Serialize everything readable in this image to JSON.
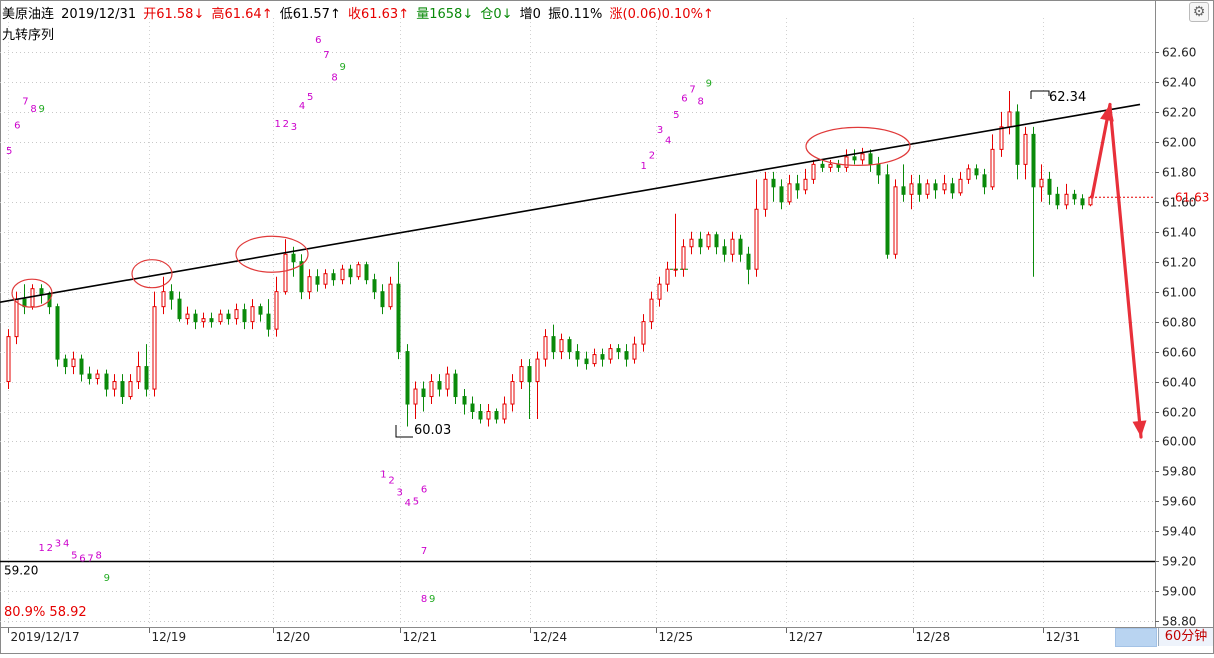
{
  "header": {
    "instrument": "美原油连",
    "date": "2019/12/31",
    "open": "开61.58↓",
    "high": "高61.64↑",
    "low": "低61.57↑",
    "close": "收61.63↑",
    "volume": "量1658↓",
    "position": "仓0↓",
    "increase": "增0",
    "amplitude": "振0.11%",
    "change": "涨(0.06)0.10%↑",
    "indicator": "九转序列"
  },
  "colors": {
    "up": "#e60000",
    "down": "#0a8a0a",
    "nine_up": "#cc00cc",
    "nine_nine": "#22aa22",
    "arrow": "#e8303a",
    "ellipse": "#e03a3a"
  },
  "footer": {
    "pct_note": "80.9% 58.92",
    "period": "60分钟"
  },
  "chart_data": {
    "type": "candlestick",
    "y_axis": {
      "ylim": [
        58.8,
        62.7
      ],
      "ticks": [
        "62.60",
        "62.40",
        "62.20",
        "62.00",
        "61.80",
        "61.60",
        "61.40",
        "61.20",
        "61.00",
        "60.80",
        "60.60",
        "60.40",
        "60.20",
        "60.00",
        "59.80",
        "59.60",
        "59.40",
        "59.20",
        "59.00",
        "58.80"
      ],
      "current_price": "61.63"
    },
    "x_axis": {
      "ticks": [
        "2019/12/17",
        "12/19",
        "12/20",
        "12/21",
        "12/24",
        "12/25",
        "12/27",
        "12/28",
        "12/31"
      ]
    },
    "annotations": {
      "high_label": "62.34",
      "low_label": "60.03",
      "support_label": "59.20",
      "support_level": 59.2,
      "trendline": {
        "start": [
          0,
          60.93
        ],
        "end": [
          142,
          62.25
        ]
      }
    },
    "candles": [
      [
        60.4,
        60.7,
        60.35,
        60.75
      ],
      [
        60.7,
        60.95,
        60.65,
        61.0
      ],
      [
        60.95,
        60.9,
        60.85,
        61.05
      ],
      [
        60.9,
        61.02,
        60.88,
        61.05
      ],
      [
        61.02,
        60.98,
        60.92,
        61.05
      ],
      [
        60.98,
        60.9,
        60.85,
        61.0
      ],
      [
        60.9,
        60.55,
        60.5,
        60.92
      ],
      [
        60.55,
        60.5,
        60.45,
        60.58
      ],
      [
        60.5,
        60.55,
        60.45,
        60.6
      ],
      [
        60.55,
        60.45,
        60.4,
        60.58
      ],
      [
        60.45,
        60.42,
        60.38,
        60.5
      ],
      [
        60.42,
        60.45,
        60.38,
        60.48
      ],
      [
        60.45,
        60.35,
        60.3,
        60.48
      ],
      [
        60.35,
        60.4,
        60.3,
        60.45
      ],
      [
        60.4,
        60.3,
        60.25,
        60.45
      ],
      [
        60.3,
        60.4,
        60.28,
        60.45
      ],
      [
        60.4,
        60.5,
        60.35,
        60.6
      ],
      [
        60.5,
        60.35,
        60.3,
        60.65
      ],
      [
        60.35,
        60.9,
        60.3,
        61.0
      ],
      [
        60.9,
        61.0,
        60.85,
        61.1
      ],
      [
        61.0,
        60.95,
        60.88,
        61.05
      ],
      [
        60.95,
        60.82,
        60.8,
        61.0
      ],
      [
        60.82,
        60.85,
        60.78,
        60.9
      ],
      [
        60.85,
        60.8,
        60.75,
        60.88
      ],
      [
        60.8,
        60.82,
        60.76,
        60.86
      ],
      [
        60.82,
        60.8,
        60.76,
        60.86
      ],
      [
        60.8,
        60.85,
        60.78,
        60.88
      ],
      [
        60.85,
        60.82,
        60.78,
        60.88
      ],
      [
        60.82,
        60.88,
        60.78,
        60.92
      ],
      [
        60.88,
        60.8,
        60.75,
        60.92
      ],
      [
        60.8,
        60.9,
        60.75,
        60.95
      ],
      [
        60.9,
        60.85,
        60.8,
        60.92
      ],
      [
        60.85,
        60.75,
        60.7,
        60.95
      ],
      [
        60.75,
        61.0,
        60.7,
        61.1
      ],
      [
        61.0,
        61.25,
        60.98,
        61.35
      ],
      [
        61.25,
        61.2,
        61.1,
        61.3
      ],
      [
        61.2,
        61.0,
        60.95,
        61.25
      ],
      [
        61.0,
        61.1,
        60.95,
        61.15
      ],
      [
        61.1,
        61.05,
        61.0,
        61.15
      ],
      [
        61.05,
        61.12,
        61.02,
        61.15
      ],
      [
        61.12,
        61.08,
        61.04,
        61.15
      ],
      [
        61.08,
        61.15,
        61.05,
        61.18
      ],
      [
        61.15,
        61.1,
        61.05,
        61.18
      ],
      [
        61.1,
        61.18,
        61.08,
        61.2
      ],
      [
        61.18,
        61.08,
        61.05,
        61.2
      ],
      [
        61.08,
        61.0,
        60.95,
        61.12
      ],
      [
        61.0,
        60.9,
        60.85,
        61.05
      ],
      [
        60.9,
        61.05,
        60.88,
        61.1
      ],
      [
        61.05,
        60.6,
        60.55,
        61.2
      ],
      [
        60.6,
        60.25,
        60.1,
        60.65
      ],
      [
        60.25,
        60.35,
        60.15,
        60.4
      ],
      [
        60.35,
        60.3,
        60.2,
        60.4
      ],
      [
        60.3,
        60.4,
        60.25,
        60.45
      ],
      [
        60.4,
        60.35,
        60.3,
        60.45
      ],
      [
        60.35,
        60.45,
        60.3,
        60.5
      ],
      [
        60.45,
        60.3,
        60.25,
        60.48
      ],
      [
        60.3,
        60.25,
        60.18,
        60.35
      ],
      [
        60.25,
        60.2,
        60.15,
        60.3
      ],
      [
        60.2,
        60.15,
        60.12,
        60.25
      ],
      [
        60.15,
        60.2,
        60.1,
        60.25
      ],
      [
        60.2,
        60.15,
        60.12,
        60.22
      ],
      [
        60.15,
        60.25,
        60.12,
        60.3
      ],
      [
        60.25,
        60.4,
        60.2,
        60.45
      ],
      [
        60.4,
        60.5,
        60.35,
        60.55
      ],
      [
        60.5,
        60.4,
        60.15,
        60.55
      ],
      [
        60.4,
        60.55,
        60.15,
        60.6
      ],
      [
        60.55,
        60.7,
        60.5,
        60.75
      ],
      [
        60.7,
        60.6,
        60.55,
        60.78
      ],
      [
        60.6,
        60.68,
        60.55,
        60.72
      ],
      [
        60.68,
        60.6,
        60.55,
        60.7
      ],
      [
        60.6,
        60.55,
        60.5,
        60.65
      ],
      [
        60.55,
        60.52,
        60.48,
        60.6
      ],
      [
        60.52,
        60.58,
        60.5,
        60.62
      ],
      [
        60.58,
        60.55,
        60.5,
        60.62
      ],
      [
        60.55,
        60.62,
        60.52,
        60.65
      ],
      [
        60.62,
        60.6,
        60.55,
        60.65
      ],
      [
        60.6,
        60.55,
        60.5,
        60.65
      ],
      [
        60.55,
        60.65,
        60.52,
        60.7
      ],
      [
        60.65,
        60.8,
        60.6,
        60.85
      ],
      [
        60.8,
        60.95,
        60.75,
        61.0
      ],
      [
        60.95,
        61.05,
        60.9,
        61.1
      ],
      [
        61.05,
        61.15,
        61.0,
        61.2
      ],
      [
        61.15,
        61.15,
        61.1,
        61.52
      ],
      [
        61.15,
        61.3,
        61.1,
        61.35
      ],
      [
        61.3,
        61.35,
        61.25,
        61.4
      ],
      [
        61.35,
        61.3,
        61.25,
        61.4
      ],
      [
        61.3,
        61.38,
        61.28,
        61.4
      ],
      [
        61.38,
        61.3,
        61.25,
        61.4
      ],
      [
        61.3,
        61.25,
        61.2,
        61.35
      ],
      [
        61.25,
        61.35,
        61.2,
        61.4
      ],
      [
        61.35,
        61.25,
        61.2,
        61.38
      ],
      [
        61.25,
        61.15,
        61.05,
        61.3
      ],
      [
        61.15,
        61.55,
        61.1,
        61.75
      ],
      [
        61.55,
        61.75,
        61.5,
        61.8
      ],
      [
        61.75,
        61.7,
        61.6,
        61.8
      ],
      [
        61.7,
        61.6,
        61.55,
        61.75
      ],
      [
        61.6,
        61.72,
        61.58,
        61.78
      ],
      [
        61.72,
        61.68,
        61.62,
        61.78
      ],
      [
        61.68,
        61.75,
        61.65,
        61.82
      ],
      [
        61.75,
        61.85,
        61.72,
        61.88
      ],
      [
        61.85,
        61.83,
        61.8,
        61.88
      ],
      [
        61.83,
        61.85,
        61.8,
        61.88
      ],
      [
        61.85,
        61.83,
        61.8,
        61.88
      ],
      [
        61.83,
        61.9,
        61.8,
        61.95
      ],
      [
        61.9,
        61.88,
        61.85,
        61.95
      ],
      [
        61.88,
        61.92,
        61.85,
        61.96
      ],
      [
        61.92,
        61.85,
        61.8,
        61.95
      ],
      [
        61.85,
        61.78,
        61.72,
        61.9
      ],
      [
        61.78,
        61.25,
        61.22,
        61.85
      ],
      [
        61.25,
        61.7,
        61.22,
        61.75
      ],
      [
        61.7,
        61.65,
        61.6,
        61.85
      ],
      [
        61.65,
        61.72,
        61.55,
        61.78
      ],
      [
        61.72,
        61.65,
        61.6,
        61.78
      ],
      [
        61.65,
        61.72,
        61.62,
        61.75
      ],
      [
        61.72,
        61.68,
        61.62,
        61.75
      ],
      [
        61.68,
        61.72,
        61.65,
        61.78
      ],
      [
        61.72,
        61.66,
        61.62,
        61.76
      ],
      [
        61.66,
        61.75,
        61.64,
        61.8
      ],
      [
        61.75,
        61.82,
        61.72,
        61.85
      ],
      [
        61.82,
        61.78,
        61.75,
        61.85
      ],
      [
        61.78,
        61.7,
        61.65,
        61.82
      ],
      [
        61.7,
        61.95,
        61.68,
        62.05
      ],
      [
        61.95,
        62.1,
        61.9,
        62.2
      ],
      [
        62.1,
        62.2,
        62.05,
        62.34
      ],
      [
        62.2,
        61.85,
        61.75,
        62.25
      ],
      [
        61.85,
        62.05,
        61.75,
        62.1
      ],
      [
        62.05,
        61.7,
        61.1,
        62.1
      ],
      [
        61.7,
        61.75,
        61.6,
        61.85
      ],
      [
        61.75,
        61.65,
        61.58,
        61.8
      ],
      [
        61.65,
        61.58,
        61.55,
        61.7
      ],
      [
        61.58,
        61.65,
        61.55,
        61.72
      ],
      [
        61.65,
        61.62,
        61.58,
        61.68
      ],
      [
        61.62,
        61.58,
        61.55,
        61.65
      ],
      [
        61.58,
        61.63,
        61.57,
        61.64
      ]
    ],
    "td_sequence": [
      {
        "label": "5",
        "i": 0,
        "price": 61.92,
        "kind": "up"
      },
      {
        "label": "6",
        "i": 1,
        "price": 62.09,
        "kind": "up"
      },
      {
        "label": "7",
        "i": 2,
        "price": 62.25,
        "kind": "up"
      },
      {
        "label": "8",
        "i": 3,
        "price": 62.2,
        "kind": "up"
      },
      {
        "label": "9",
        "i": 4,
        "price": 62.2,
        "kind": "nine"
      },
      {
        "label": "1",
        "i": 33,
        "price": 62.1,
        "kind": "up"
      },
      {
        "label": "2",
        "i": 34,
        "price": 62.1,
        "kind": "up"
      },
      {
        "label": "3",
        "i": 35,
        "price": 62.08,
        "kind": "up"
      },
      {
        "label": "4",
        "i": 36,
        "price": 62.22,
        "kind": "up"
      },
      {
        "label": "5",
        "i": 37,
        "price": 62.28,
        "kind": "up"
      },
      {
        "label": "6",
        "i": 38,
        "price": 62.66,
        "kind": "up"
      },
      {
        "label": "7",
        "i": 39,
        "price": 62.56,
        "kind": "up"
      },
      {
        "label": "8",
        "i": 40,
        "price": 62.41,
        "kind": "up"
      },
      {
        "label": "9",
        "i": 41,
        "price": 62.48,
        "kind": "nine"
      },
      {
        "label": "1",
        "i": 78,
        "price": 61.82,
        "kind": "up"
      },
      {
        "label": "2",
        "i": 79,
        "price": 61.89,
        "kind": "up"
      },
      {
        "label": "3",
        "i": 80,
        "price": 62.06,
        "kind": "up"
      },
      {
        "label": "4",
        "i": 81,
        "price": 61.99,
        "kind": "up"
      },
      {
        "label": "5",
        "i": 82,
        "price": 62.16,
        "kind": "up"
      },
      {
        "label": "6",
        "i": 83,
        "price": 62.27,
        "kind": "up"
      },
      {
        "label": "7",
        "i": 84,
        "price": 62.33,
        "kind": "up"
      },
      {
        "label": "8",
        "i": 85,
        "price": 62.25,
        "kind": "up"
      },
      {
        "label": "9",
        "i": 86,
        "price": 62.37,
        "kind": "nine"
      },
      {
        "label": "1",
        "i": 4,
        "price": 59.27,
        "kind": "up"
      },
      {
        "label": "2",
        "i": 5,
        "price": 59.27,
        "kind": "up"
      },
      {
        "label": "3",
        "i": 6,
        "price": 59.3,
        "kind": "up"
      },
      {
        "label": "4",
        "i": 7,
        "price": 59.3,
        "kind": "up"
      },
      {
        "label": "5",
        "i": 8,
        "price": 59.22,
        "kind": "up"
      },
      {
        "label": "6",
        "i": 9,
        "price": 59.2,
        "kind": "up"
      },
      {
        "label": "7",
        "i": 10,
        "price": 59.2,
        "kind": "up"
      },
      {
        "label": "8",
        "i": 11,
        "price": 59.22,
        "kind": "up"
      },
      {
        "label": "9",
        "i": 12,
        "price": 59.07,
        "kind": "nine"
      },
      {
        "label": "1",
        "i": 46,
        "price": 59.76,
        "kind": "up"
      },
      {
        "label": "2",
        "i": 47,
        "price": 59.72,
        "kind": "up"
      },
      {
        "label": "3",
        "i": 48,
        "price": 59.64,
        "kind": "up"
      },
      {
        "label": "4",
        "i": 49,
        "price": 59.57,
        "kind": "up"
      },
      {
        "label": "5",
        "i": 50,
        "price": 59.58,
        "kind": "up"
      },
      {
        "label": "6",
        "i": 51,
        "price": 59.66,
        "kind": "up"
      },
      {
        "label": "7",
        "i": 51,
        "price": 59.25,
        "kind": "up"
      },
      {
        "label": "8",
        "i": 51,
        "price": 58.93,
        "kind": "up"
      },
      {
        "label": "9",
        "i": 52,
        "price": 58.93,
        "kind": "nine"
      }
    ]
  }
}
